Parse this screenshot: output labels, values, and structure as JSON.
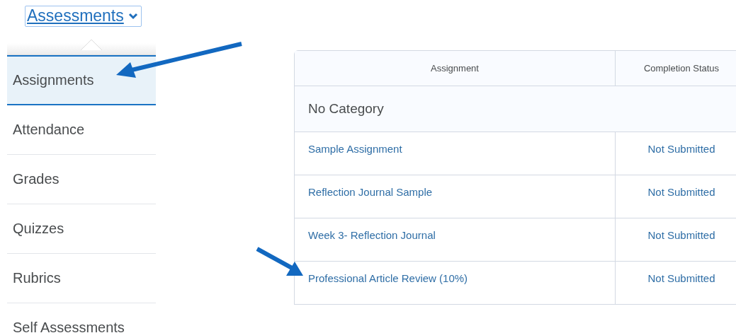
{
  "menu_button": {
    "label": "Assessments",
    "expanded": true
  },
  "menu": {
    "items": [
      {
        "label": "Assignments",
        "selected": true
      },
      {
        "label": "Attendance",
        "selected": false
      },
      {
        "label": "Grades",
        "selected": false
      },
      {
        "label": "Quizzes",
        "selected": false
      },
      {
        "label": "Rubrics",
        "selected": false
      },
      {
        "label": "Self Assessments",
        "selected": false
      }
    ]
  },
  "table": {
    "columns": [
      "Assignment",
      "Completion Status"
    ],
    "category": "No Category",
    "rows": [
      {
        "assignment": "Sample Assignment",
        "status": "Not Submitted"
      },
      {
        "assignment": "Reflection Journal Sample",
        "status": "Not Submitted"
      },
      {
        "assignment": "Week 3- Reflection Journal",
        "status": "Not Submitted"
      },
      {
        "assignment": "Professional Article Review (10%)",
        "status": "Not Submitted"
      }
    ]
  }
}
